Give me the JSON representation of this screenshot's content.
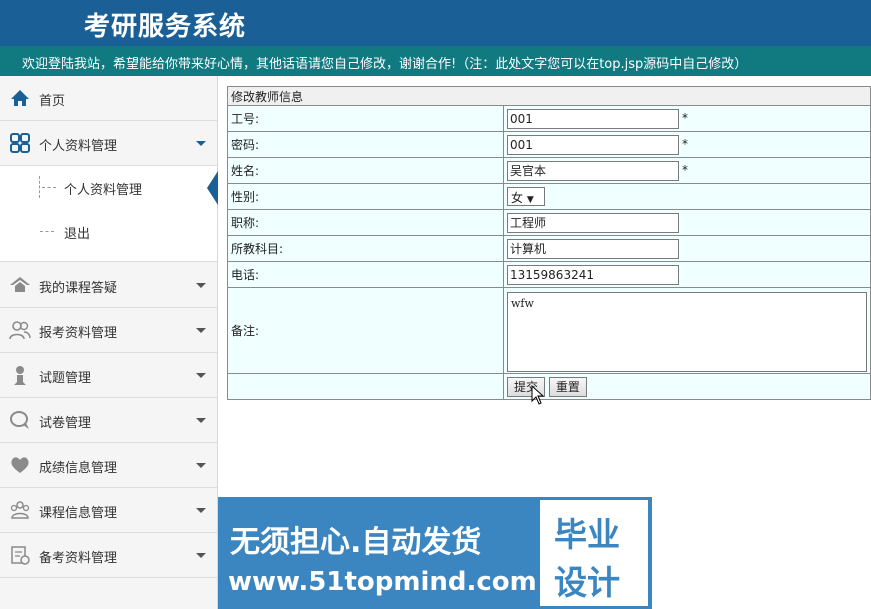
{
  "header": {
    "title": "考研服务系统"
  },
  "banner": {
    "text": "欢迎登陆我站，希望能给你带来好心情，其他话语请您自己修改，谢谢合作!（注：此处文字您可以在top.jsp源码中自己修改）"
  },
  "sidebar": {
    "items": [
      {
        "label": "首页",
        "icon": "home-icon"
      },
      {
        "label": "个人资料管理",
        "icon": "grid-icon"
      },
      {
        "label": "我的课程答疑",
        "icon": "house-icon"
      },
      {
        "label": "报考资料管理",
        "icon": "users-icon"
      },
      {
        "label": "试题管理",
        "icon": "user-icon"
      },
      {
        "label": "试卷管理",
        "icon": "chat-icon"
      },
      {
        "label": "成绩信息管理",
        "icon": "heart-icon"
      },
      {
        "label": "课程信息管理",
        "icon": "group-icon"
      },
      {
        "label": "备考资料管理",
        "icon": "document-icon"
      }
    ],
    "sub_items": [
      {
        "label": "个人资料管理"
      },
      {
        "label": "退出"
      }
    ]
  },
  "form": {
    "caption": "修改教师信息",
    "fields": {
      "gonghao": {
        "label": "工号:",
        "value": "001",
        "required": "*"
      },
      "mima": {
        "label": "密码:",
        "value": "001",
        "required": "*"
      },
      "xingming": {
        "label": "姓名:",
        "value": "吴官本",
        "required": "*"
      },
      "xingbie": {
        "label": "性别:",
        "value": "女"
      },
      "zhicheng": {
        "label": "职称:",
        "value": "工程师"
      },
      "kemu": {
        "label": "所教科目:",
        "value": "计算机"
      },
      "dianhua": {
        "label": "电话:",
        "value": "13159863241"
      },
      "beizhu": {
        "label": "备注:",
        "value": "wfw"
      }
    },
    "submit_label": "提交",
    "reset_label": "重置"
  },
  "watermark": {
    "line1": "无须担心.自动发货",
    "line2": "www.51topmind.com",
    "badge_line1": "毕业",
    "badge_line2": "设计"
  }
}
